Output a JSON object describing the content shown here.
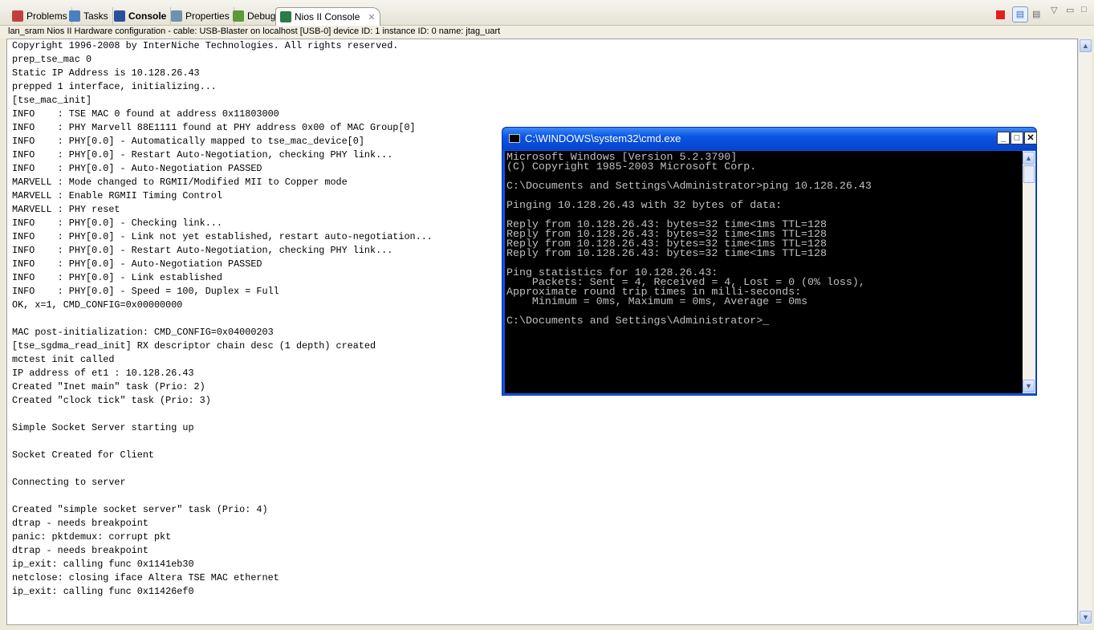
{
  "tabs": [
    {
      "label": "Problems",
      "icon": "problems-icon"
    },
    {
      "label": "Tasks",
      "icon": "tasks-icon"
    },
    {
      "label": "Console",
      "icon": "console-icon"
    },
    {
      "label": "Properties",
      "icon": "properties-icon"
    },
    {
      "label": "Debug",
      "icon": "debug-icon"
    },
    {
      "label": "Nios II Console",
      "icon": "nios-console-icon",
      "active": true
    }
  ],
  "status": "lan_sram Nios II Hardware configuration - cable: USB-Blaster on localhost [USB-0] device ID: 1 instance ID: 0 name: jtag_uart",
  "console_lines": [
    "Copyright 1996-2008 by InterNiche Technologies. All rights reserved.",
    "prep_tse_mac 0",
    "Static IP Address is 10.128.26.43",
    "prepped 1 interface, initializing...",
    "[tse_mac_init]",
    "INFO    : TSE MAC 0 found at address 0x11803000",
    "INFO    : PHY Marvell 88E1111 found at PHY address 0x00 of MAC Group[0]",
    "INFO    : PHY[0.0] - Automatically mapped to tse_mac_device[0]",
    "INFO    : PHY[0.0] - Restart Auto-Negotiation, checking PHY link...",
    "INFO    : PHY[0.0] - Auto-Negotiation PASSED",
    "MARVELL : Mode changed to RGMII/Modified MII to Copper mode",
    "MARVELL : Enable RGMII Timing Control",
    "MARVELL : PHY reset",
    "INFO    : PHY[0.0] - Checking link...",
    "INFO    : PHY[0.0] - Link not yet established, restart auto-negotiation...",
    "INFO    : PHY[0.0] - Restart Auto-Negotiation, checking PHY link...",
    "INFO    : PHY[0.0] - Auto-Negotiation PASSED",
    "INFO    : PHY[0.0] - Link established",
    "INFO    : PHY[0.0] - Speed = 100, Duplex = Full",
    "OK, x=1, CMD_CONFIG=0x00000000",
    "",
    "MAC post-initialization: CMD_CONFIG=0x04000203",
    "[tse_sgdma_read_init] RX descriptor chain desc (1 depth) created",
    "mctest init called",
    "IP address of et1 : 10.128.26.43",
    "Created \"Inet main\" task (Prio: 2)",
    "Created \"clock tick\" task (Prio: 3)",
    "",
    "Simple Socket Server starting up",
    "",
    "Socket Created for Client",
    "",
    "Connecting to server",
    "",
    "Created \"simple socket server\" task (Prio: 4)",
    "dtrap - needs breakpoint",
    "panic: pktdemux: corrupt pkt",
    "dtrap - needs breakpoint",
    "ip_exit: calling func 0x1141eb30",
    "netclose: closing iface Altera TSE MAC ethernet",
    "ip_exit: calling func 0x11426ef0"
  ],
  "cmd": {
    "title": "C:\\WINDOWS\\system32\\cmd.exe",
    "lines": [
      "Microsoft Windows [Version 5.2.3790]",
      "(C) Copyright 1985-2003 Microsoft Corp.",
      "",
      "C:\\Documents and Settings\\Administrator>ping 10.128.26.43",
      "",
      "Pinging 10.128.26.43 with 32 bytes of data:",
      "",
      "Reply from 10.128.26.43: bytes=32 time<1ms TTL=128",
      "Reply from 10.128.26.43: bytes=32 time<1ms TTL=128",
      "Reply from 10.128.26.43: bytes=32 time<1ms TTL=128",
      "Reply from 10.128.26.43: bytes=32 time<1ms TTL=128",
      "",
      "Ping statistics for 10.128.26.43:",
      "    Packets: Sent = 4, Received = 4, Lost = 0 (0% loss),",
      "Approximate round trip times in milli-seconds:",
      "    Minimum = 0ms, Maximum = 0ms, Average = 0ms",
      "",
      "C:\\Documents and Settings\\Administrator>_"
    ]
  },
  "colors": {
    "titlebar": "#0a55e5",
    "terminate": "#e02020"
  }
}
